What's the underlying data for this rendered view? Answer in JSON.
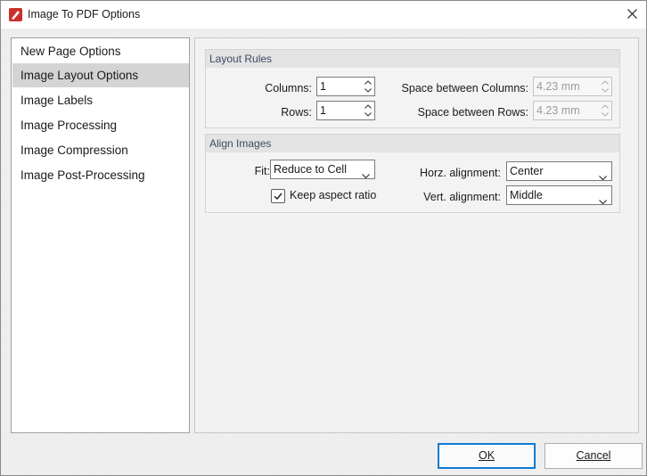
{
  "window": {
    "title": "Image To PDF Options",
    "app_icon": "pdf-editor-icon",
    "close_icon": "close-icon"
  },
  "nav": {
    "items": [
      {
        "label": "New Page Options",
        "selected": false
      },
      {
        "label": "Image Layout Options",
        "selected": true
      },
      {
        "label": "Image Labels",
        "selected": false
      },
      {
        "label": "Image Processing",
        "selected": false
      },
      {
        "label": "Image Compression",
        "selected": false
      },
      {
        "label": "Image Post-Processing",
        "selected": false
      }
    ]
  },
  "layout_rules": {
    "title": "Layout Rules",
    "columns_label": "Columns:",
    "columns_value": "1",
    "rows_label": "Rows:",
    "rows_value": "1",
    "space_columns_label": "Space between Columns:",
    "space_columns_value": "4.23 mm",
    "space_rows_label": "Space between Rows:",
    "space_rows_value": "4.23 mm"
  },
  "align_images": {
    "title": "Align Images",
    "fit_label": "Fit:",
    "fit_value": "Reduce to Cell",
    "keep_aspect_label": "Keep aspect ratio",
    "keep_aspect_checked": true,
    "horz_label": "Horz. alignment:",
    "horz_value": "Center",
    "vert_label": "Vert. alignment:",
    "vert_value": "Middle"
  },
  "buttons": {
    "ok_label": "OK",
    "cancel_label": "Cancel"
  },
  "colors": {
    "accent": "#0f7ad8",
    "selected_nav": "#d4d4d4",
    "group_header_text": "#3c4a63"
  }
}
